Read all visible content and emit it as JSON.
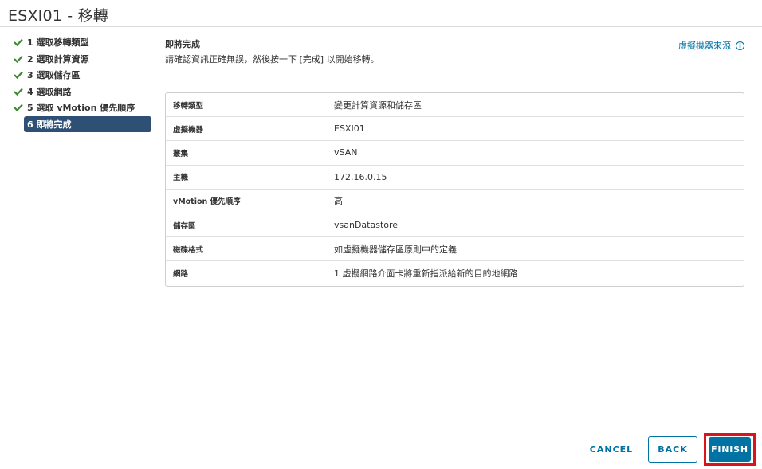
{
  "dialog": {
    "title": "ESXI01 - 移轉"
  },
  "steps": [
    {
      "label": "1 選取移轉類型",
      "done": true
    },
    {
      "label": "2 選取計算資源",
      "done": true
    },
    {
      "label": "3 選取儲存區",
      "done": true
    },
    {
      "label": "4 選取網路",
      "done": true
    },
    {
      "label": "5 選取 vMotion 優先順序",
      "done": true
    },
    {
      "label": "6 即將完成",
      "done": false,
      "active": true
    }
  ],
  "header": {
    "heading": "即將完成",
    "description": "請確認資訊正確無誤，然後按一下 [完成] 以開始移轉。",
    "source_link": "虛擬機器來源",
    "info_icon": "info-icon"
  },
  "summary": [
    {
      "key": "移轉類型",
      "value": "變更計算資源和儲存區"
    },
    {
      "key": "虛擬機器",
      "value": "ESXI01"
    },
    {
      "key": "叢集",
      "value": "vSAN"
    },
    {
      "key": "主機",
      "value": "172.16.0.15"
    },
    {
      "key": "vMotion 優先順序",
      "value": "高"
    },
    {
      "key": "儲存區",
      "value": "vsanDatastore"
    },
    {
      "key": "磁碟格式",
      "value": "如虛擬機器儲存區原則中的定義"
    },
    {
      "key": "網路",
      "value": "1 虛擬網路介面卡將重新指派給新的目的地網路"
    }
  ],
  "buttons": {
    "cancel": "CANCEL",
    "back": "BACK",
    "finish": "FINISH"
  },
  "colors": {
    "accent": "#0072a3",
    "check": "#3c8a2e",
    "active_step": "#2e5075",
    "highlight": "#d9141e"
  }
}
